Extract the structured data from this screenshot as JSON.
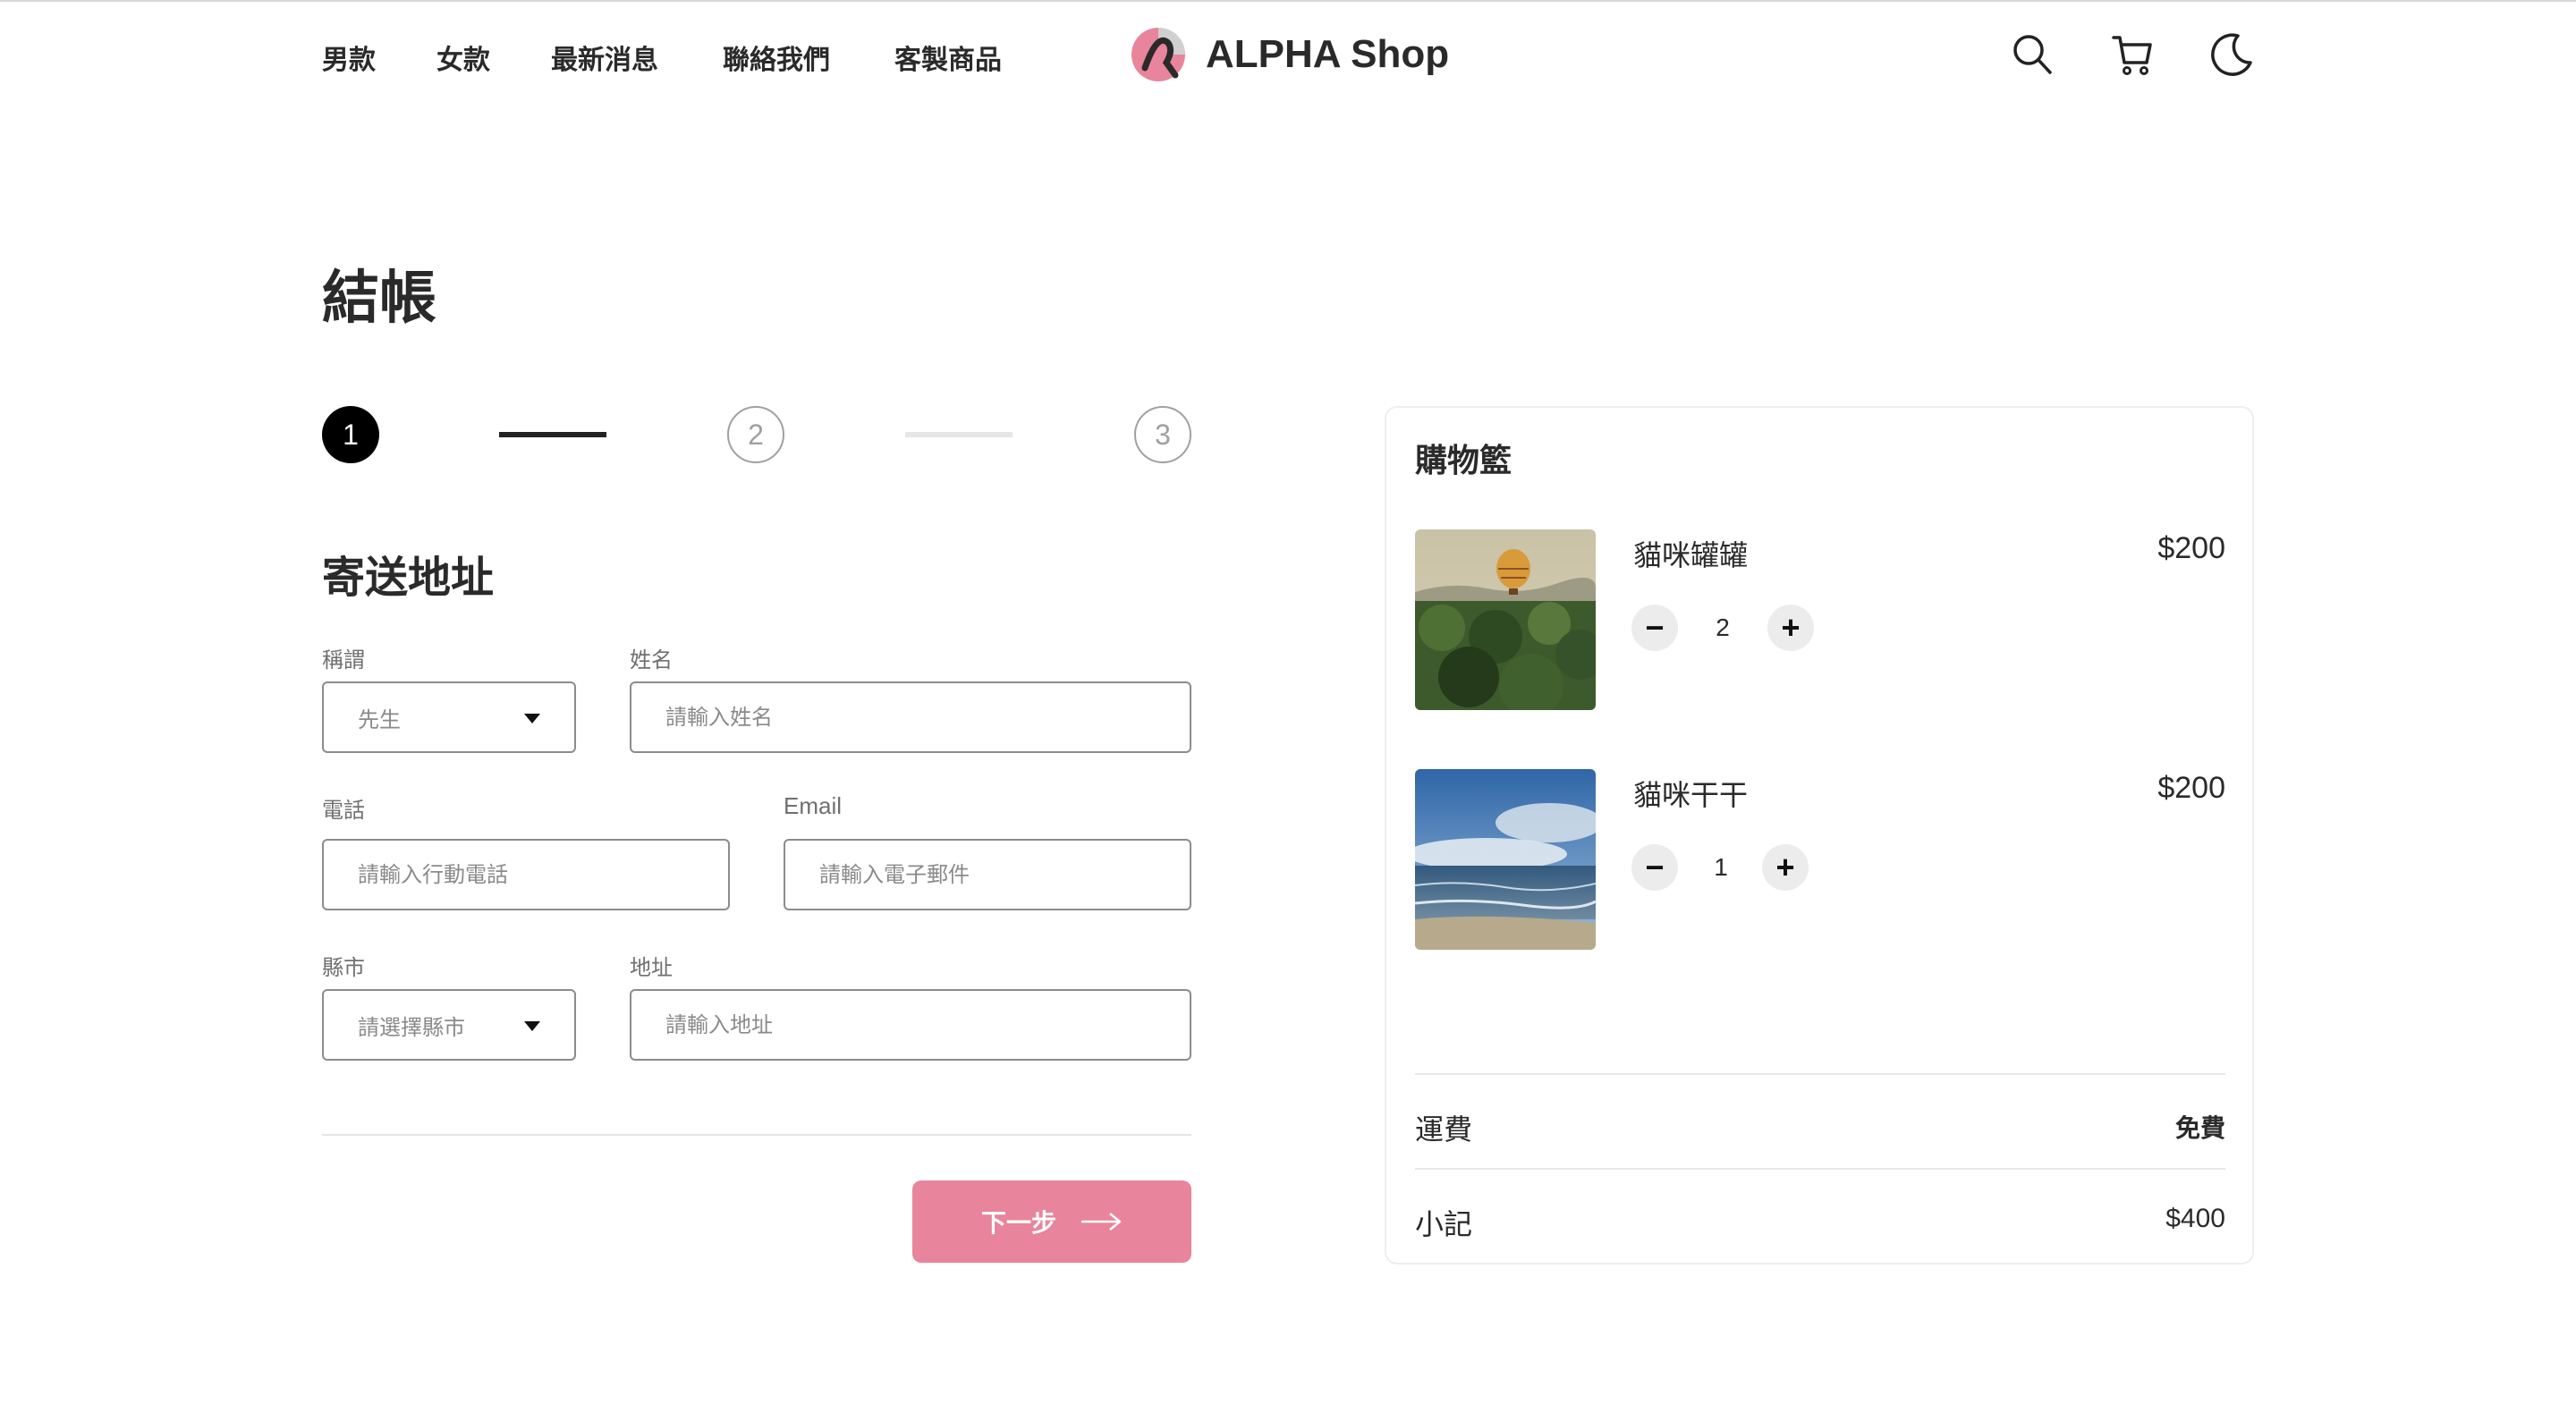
{
  "header": {
    "nav": [
      "男款",
      "女款",
      "最新消息",
      "聯絡我們",
      "客製商品"
    ],
    "logo_text": "ALPHA Shop",
    "icons": [
      "search-icon",
      "cart-icon",
      "moon-icon"
    ]
  },
  "page": {
    "title": "結帳"
  },
  "stepper": {
    "steps": [
      "1",
      "2",
      "3"
    ],
    "active_step": 1
  },
  "form": {
    "section_title": "寄送地址",
    "salutation": {
      "label": "稱謂",
      "value": "先生"
    },
    "name": {
      "label": "姓名",
      "placeholder": "請輸入姓名"
    },
    "phone": {
      "label": "電話",
      "placeholder": "請輸入行動電話"
    },
    "email": {
      "label": "Email",
      "placeholder": "請輸入電子郵件"
    },
    "city": {
      "label": "縣市",
      "placeholder": "請選擇縣市"
    },
    "address": {
      "label": "地址",
      "placeholder": "請輸入地址"
    },
    "next_label": "下一步"
  },
  "cart": {
    "title": "購物籃",
    "items": [
      {
        "name": "貓咪罐罐",
        "price": "$200",
        "quantity": "2"
      },
      {
        "name": "貓咪干干",
        "price": "$200",
        "quantity": "1"
      }
    ],
    "shipping": {
      "label": "運費",
      "value": "免費"
    },
    "subtotal": {
      "label": "小記",
      "value": "$400"
    }
  },
  "colors": {
    "accent": "#e8849b",
    "text": "#2a2a2a",
    "border": "#8c8c8c"
  }
}
